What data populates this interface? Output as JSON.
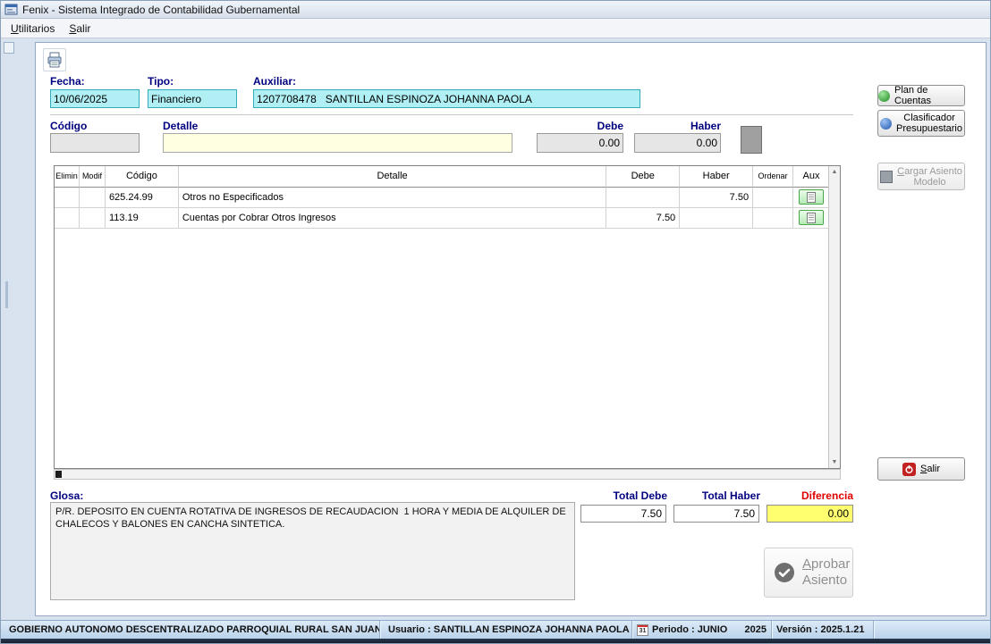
{
  "window": {
    "title": "Fenix - Sistema Integrado de Contabilidad Gubernamental"
  },
  "menu": {
    "items": [
      {
        "pre": "U",
        "rest": "tilitarios"
      },
      {
        "pre": "S",
        "rest": "alir"
      }
    ]
  },
  "header_fields": {
    "fecha_label": "Fecha:",
    "fecha_value": "10/06/2025",
    "tipo_label": "Tipo:",
    "tipo_value": "Financiero",
    "auxiliar_label": "Auxiliar:",
    "auxiliar_value": "1207708478   SANTILLAN ESPINOZA JOHANNA PAOLA"
  },
  "entry": {
    "codigo_label": "Código",
    "detalle_label": "Detalle",
    "debe_label": "Debe",
    "haber_label": "Haber",
    "codigo_value": "",
    "detalle_value": "",
    "debe_value": "0.00",
    "haber_value": "0.00"
  },
  "grid": {
    "headers": [
      "Elimin",
      "Modif",
      "Código",
      "Detalle",
      "Debe",
      "Haber",
      "Ordenar",
      "Aux"
    ],
    "rows": [
      {
        "codigo": "625.24.99",
        "detalle": "Otros no Especificados",
        "debe": "",
        "haber": "7.50"
      },
      {
        "codigo": "113.19",
        "detalle": "Cuentas por Cobrar Otros Ingresos",
        "debe": "7.50",
        "haber": ""
      }
    ]
  },
  "glosa": {
    "label": "Glosa:",
    "text": "P/R. DEPOSITO EN CUENTA ROTATIVA DE INGRESOS DE RECAUDACION  1 HORA Y MEDIA DE ALQUILER DE CHALECOS Y BALONES EN CANCHA SINTETICA."
  },
  "totals": {
    "debe_label": "Total Debe",
    "haber_label": "Total Haber",
    "diferencia_label": "Diferencia",
    "debe": "7.50",
    "haber": "7.50",
    "diferencia": "0.00"
  },
  "side_buttons": {
    "plan": {
      "label": "Plan de Cuentas"
    },
    "clasificador": {
      "line1": "Clasificador",
      "line2": "Presupuestario"
    },
    "cargar": {
      "pre": "C",
      "rest": "argar Asiento",
      "line2": "Modelo"
    },
    "salir": {
      "pre": "S",
      "rest": "alir"
    }
  },
  "aprobar": {
    "pre": "A",
    "rest": "probar",
    "line2": "Asiento"
  },
  "statusbar": {
    "entity": "GOBIERNO AUTONOMO DESCENTRALIZADO PARROQUIAL RURAL SAN JUAN",
    "usuario": "Usuario : SANTILLAN ESPINOZA JOHANNA PAOLA",
    "periodo": "Periodo : JUNIO",
    "anio": "2025",
    "version": "Versión : 2025.1.21",
    "calendar_day": "31"
  },
  "icons": {
    "app": "app-icon",
    "print": "print-icon",
    "plan": "green-sphere-icon",
    "clasificador": "blue-sphere-icon",
    "cargar": "gray-square-icon",
    "salir": "power-icon",
    "aprobar": "check-circle-icon",
    "aux": "document-icon",
    "entity": "globe-icon",
    "user": "user-icon",
    "periodo": "calendar-icon"
  },
  "colors": {
    "navy_label": "#000080",
    "cyan_field_bg": "#b0f0f4",
    "cyan_field_border": "#35aab8",
    "detalle_field_bg": "#ffffe1",
    "diferencia_bg": "#ffff70",
    "diferencia_label": "#e00000",
    "aux_button_green": "#49a749",
    "statusbar_bg": "#cfe2f4",
    "taskbar": "#0d1420"
  }
}
